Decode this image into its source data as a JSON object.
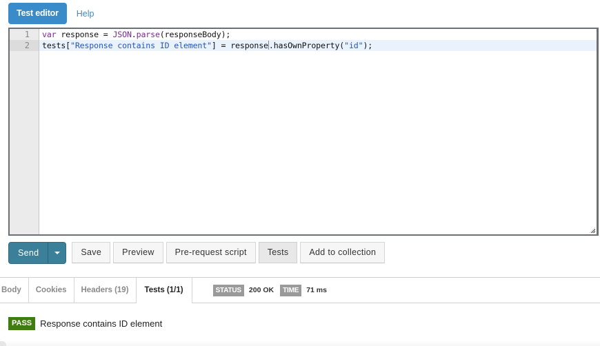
{
  "top_tabs": {
    "active": "Test editor",
    "help": "Help"
  },
  "editor": {
    "line_numbers": [
      "1",
      "2"
    ],
    "lines": [
      {
        "tokens": [
          {
            "t": "var",
            "c": "kw"
          },
          {
            "t": " response = ",
            "c": ""
          },
          {
            "t": "JSON",
            "c": "kw"
          },
          {
            "t": ".",
            "c": ""
          },
          {
            "t": "parse",
            "c": "kw"
          },
          {
            "t": "(responseBody);",
            "c": ""
          }
        ]
      },
      {
        "tokens": [
          {
            "t": "tests[",
            "c": ""
          },
          {
            "t": "\"Response contains ID element\"",
            "c": "str"
          },
          {
            "t": "] = response",
            "c": ""
          },
          {
            "t": "|",
            "c": "cursor"
          },
          {
            "t": ".hasOwnProperty(",
            "c": ""
          },
          {
            "t": "\"id\"",
            "c": "str"
          },
          {
            "t": ");",
            "c": ""
          }
        ]
      }
    ],
    "active_line": 2,
    "colors": {
      "keyword": "#7a2a8e",
      "string": "#2a56b8"
    }
  },
  "actions": {
    "send": "Send",
    "save": "Save",
    "preview": "Preview",
    "prerequest": "Pre-request script",
    "tests": "Tests",
    "add_to_collection": "Add to collection"
  },
  "response": {
    "tabs": [
      "Body",
      "Cookies",
      "Headers (19)",
      "Tests (1/1)"
    ],
    "active_tab": "Tests (1/1)",
    "status_label": "STATUS",
    "status_value": "200 OK",
    "time_label": "TIME",
    "time_value": "71 ms"
  },
  "results": [
    {
      "badge": "PASS",
      "text": "Response contains ID element",
      "color": "#3f7d0e"
    }
  ]
}
